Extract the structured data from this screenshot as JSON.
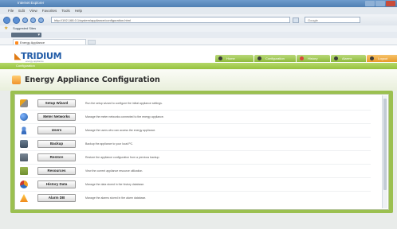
{
  "browser": {
    "window_title": "Internet Explorer",
    "menu": [
      "File",
      "Edit",
      "View",
      "Favorites",
      "Tools",
      "Help"
    ],
    "url": "http://192.168.0.1/system/appliance/configuration.html",
    "search_placeholder": "Google",
    "favorites_label": "Suggested Sites",
    "tab_label": "Energy Appliance"
  },
  "app": {
    "logo_brand": "TRIDIUM",
    "logo_sub": "energy appliance",
    "nav_tabs": [
      "Home",
      "Configuration",
      "History",
      "Alarms",
      "Logout"
    ],
    "strip_label": "Configuration",
    "page_title": "Energy Appliance Configuration"
  },
  "rows": [
    {
      "label": "Setup Wizard",
      "desc": "Run the setup wizard to configure the initial appliance settings.",
      "icon": "wand-icon"
    },
    {
      "label": "Meter Networks",
      "desc": "Manage the meter networks connected to the energy appliance.",
      "icon": "globe-icon"
    },
    {
      "label": "Users",
      "desc": "Manage the users who can access the energy appliance.",
      "icon": "users-icon"
    },
    {
      "label": "Backup",
      "desc": "Backup the appliance to your local PC.",
      "icon": "backup-icon"
    },
    {
      "label": "Restore",
      "desc": "Restore the appliance configuration from a previous backup.",
      "icon": "restore-icon"
    },
    {
      "label": "Resources",
      "desc": "View the current appliance resource utilization.",
      "icon": "resources-icon"
    },
    {
      "label": "History Data",
      "desc": "Manage the data stored in the history database.",
      "icon": "pie-chart-icon"
    },
    {
      "label": "Alarm DB",
      "desc": "Manage the alarms stored in the alarm database.",
      "icon": "alarm-icon"
    }
  ]
}
